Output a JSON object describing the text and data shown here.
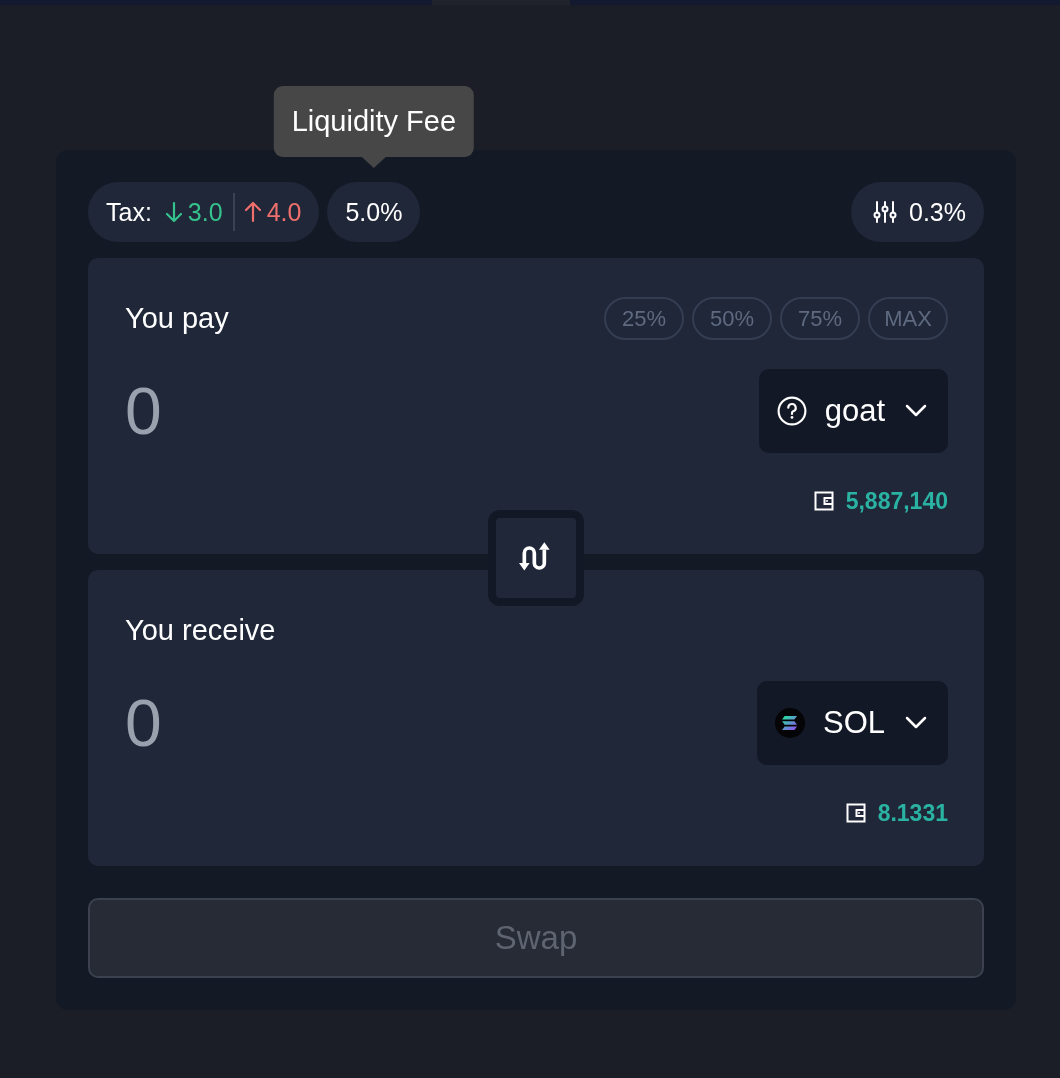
{
  "tooltip": {
    "text": "Liquidity Fee"
  },
  "fee_bar": {
    "tax_label": "Tax:",
    "buy_tax": "3.0",
    "sell_tax": "4.0",
    "fee": "5.0%",
    "slippage": "0.3%"
  },
  "pay": {
    "label": "You pay",
    "amount_placeholder": "0",
    "presets": [
      {
        "label": "25%",
        "disabled": true
      },
      {
        "label": "50%",
        "disabled": true
      },
      {
        "label": "75%",
        "disabled": true
      },
      {
        "label": "MAX",
        "disabled": true
      }
    ],
    "token": {
      "symbol": "goat",
      "kind": "unknown"
    },
    "balance": "5,887,140"
  },
  "receive": {
    "label": "You receive",
    "amount_placeholder": "0",
    "token": {
      "symbol": "SOL",
      "kind": "sol"
    },
    "balance": "8.1331"
  },
  "swap_button": {
    "label": "Swap",
    "disabled": true
  }
}
